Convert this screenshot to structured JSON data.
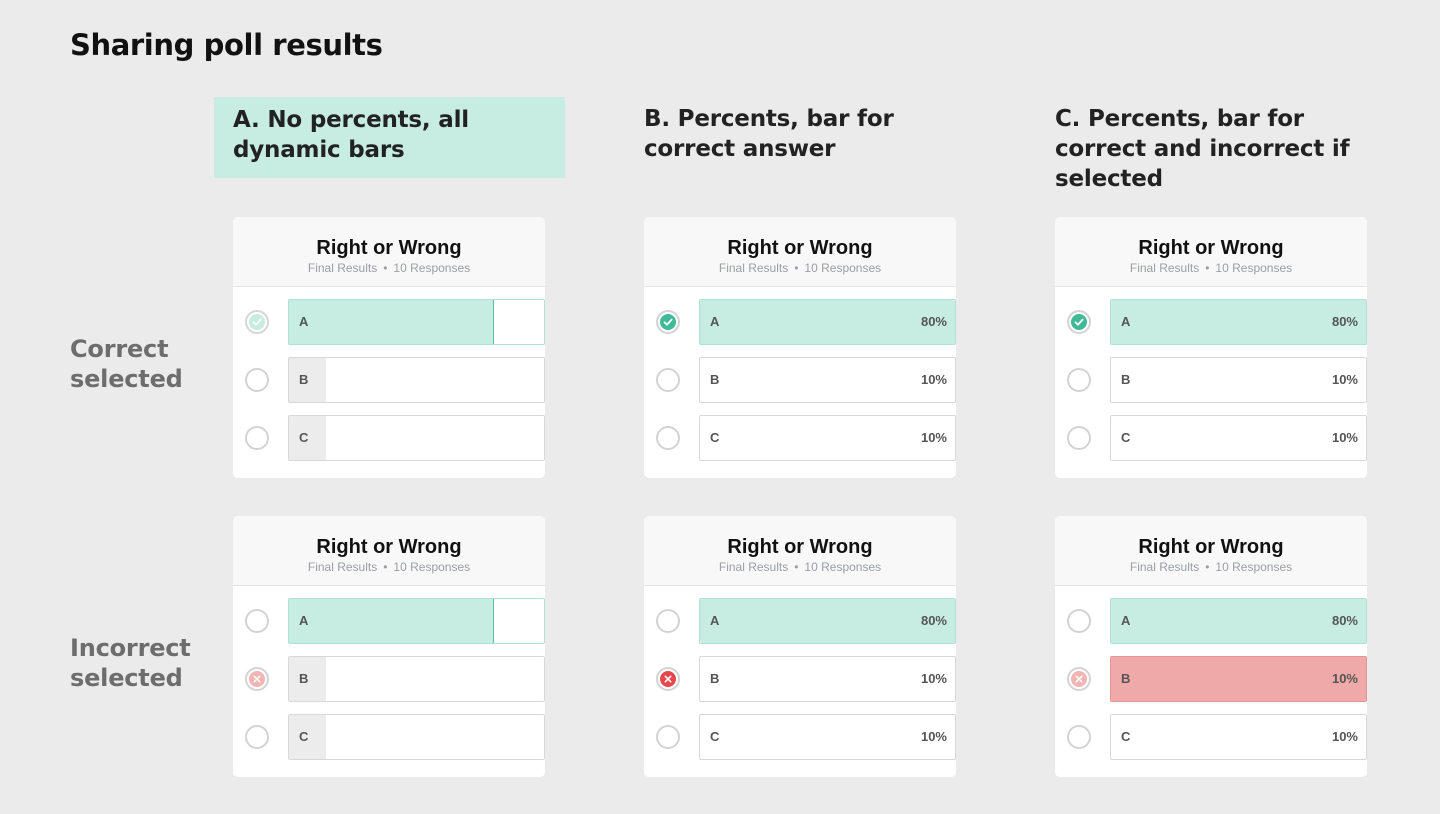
{
  "page": {
    "title": "Sharing poll results"
  },
  "columns": [
    {
      "heading": "A. No percents, all dynamic bars"
    },
    {
      "heading": "B. Percents, bar for correct answer"
    },
    {
      "heading": "C. Percents, bar for correct and incorrect if selected"
    }
  ],
  "rows": [
    {
      "label": "Correct selected"
    },
    {
      "label": "Incorrect selected"
    }
  ],
  "poll": {
    "title": "Right or Wrong",
    "status": "Final Results",
    "separator": "•",
    "responses": "10 Responses",
    "options": [
      {
        "letter": "A",
        "percent": "80%",
        "share": 0.8
      },
      {
        "letter": "B",
        "percent": "10%",
        "share": 0.1
      },
      {
        "letter": "C",
        "percent": "10%",
        "share": 0.1
      }
    ]
  },
  "colors": {
    "background": "#ebebeb",
    "correct_fill": "#c7ede3",
    "correct_accent": "#3fb998",
    "incorrect_fill": "#f0a9a9",
    "incorrect_accent": "#e5484d",
    "neutral_fill": "#ececec"
  },
  "cards": [
    {
      "id": "A-correct",
      "selected": "A",
      "selected_state": "correct-faded",
      "bars": "dynamic"
    },
    {
      "id": "B-correct",
      "selected": "A",
      "selected_state": "correct",
      "bars": "correct-only"
    },
    {
      "id": "C-correct",
      "selected": "A",
      "selected_state": "correct",
      "bars": "correct-and-selected"
    },
    {
      "id": "A-incorrect",
      "selected": "B",
      "selected_state": "incorrect-faded",
      "bars": "dynamic"
    },
    {
      "id": "B-incorrect",
      "selected": "B",
      "selected_state": "incorrect",
      "bars": "correct-only"
    },
    {
      "id": "C-incorrect",
      "selected": "B",
      "selected_state": "incorrect-faded",
      "bars": "correct-and-selected"
    }
  ]
}
